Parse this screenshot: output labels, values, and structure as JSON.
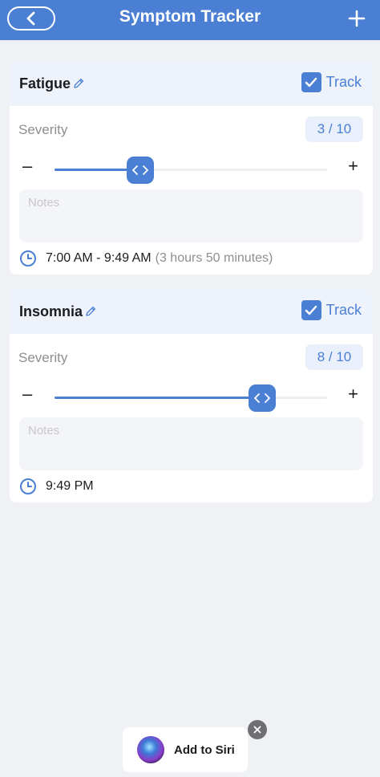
{
  "header": {
    "title": "Symptom Tracker",
    "back_icon": "chevron-left-icon",
    "add_icon": "plus-icon",
    "color": "#4a7fd4"
  },
  "symptoms": [
    {
      "name": "Fatigue",
      "track_label": "Track",
      "track_checked": true,
      "severity_label": "Severity",
      "severity_value": "3 / 10",
      "severity": 3,
      "severity_max": 10,
      "minus_label": "–",
      "plus_label": "+",
      "notes_placeholder": "Notes",
      "time": "7:00 AM - 9:49 AM",
      "duration": "(3 hours 50 minutes)"
    },
    {
      "name": "Insomnia",
      "track_label": "Track",
      "track_checked": true,
      "severity_label": "Severity",
      "severity_value": "8 / 10",
      "severity": 8,
      "severity_max": 10,
      "minus_label": "–",
      "plus_label": "+",
      "notes_placeholder": "Notes",
      "time": "9:49 PM",
      "duration": ""
    }
  ],
  "siri": {
    "label": "Add to Siri",
    "close_icon": "close-icon"
  }
}
